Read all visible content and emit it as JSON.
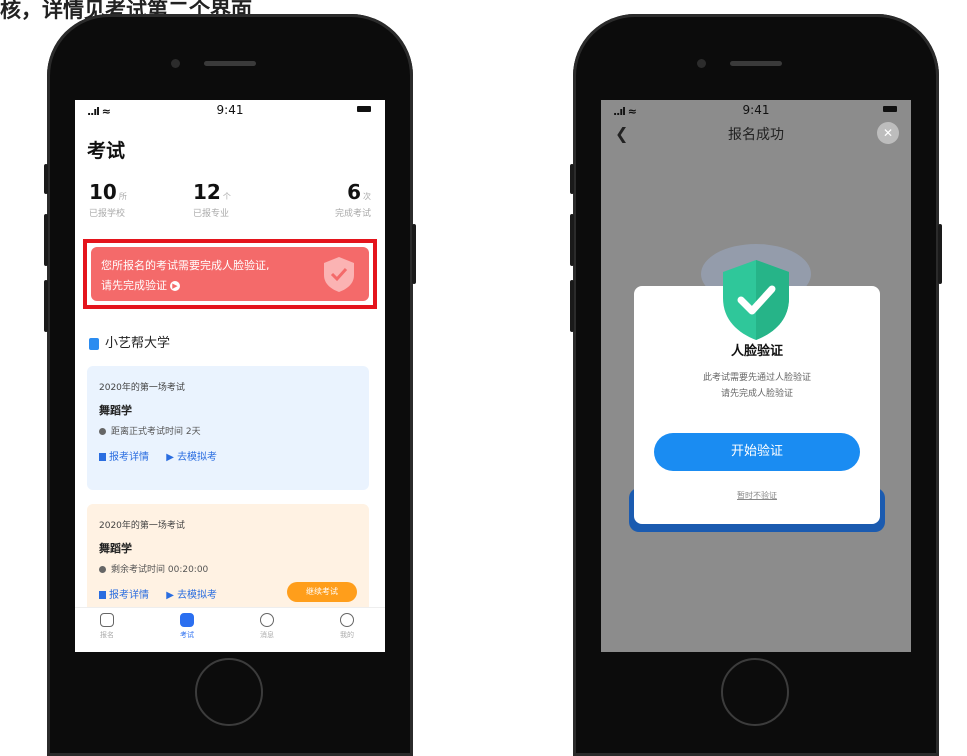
{
  "caption": "核，详情见考试第二个界面",
  "status": {
    "time": "9:41",
    "signal": "..ıl ≈"
  },
  "exam_page": {
    "title": "考试",
    "stats": [
      {
        "num": "10",
        "unit": "所",
        "label": "已报学校"
      },
      {
        "num": "12",
        "unit": "个",
        "label": "已报专业"
      },
      {
        "num": "6",
        "unit": "次",
        "label": "完成考试"
      }
    ],
    "banner": {
      "line1": "您所报名的考试需要完成人脸验证,",
      "line2": "请先完成验证"
    },
    "school": "小艺帮大学",
    "cards": [
      {
        "sub": "2020年的第一场考试",
        "name": "舞蹈学",
        "info": "距离正式考试时间 2天",
        "link1": "报考详情",
        "link2": "去模拟考",
        "bg": "#eaf3fe"
      },
      {
        "sub": "2020年的第一场考试",
        "name": "舞蹈学",
        "info": "剩余考试时间 00:20:00",
        "link1": "报考详情",
        "link2": "去模拟考",
        "button": "继续考试",
        "bg": "#fff2e3"
      }
    ],
    "tabs": [
      "报名",
      "考试",
      "消息",
      "我的"
    ]
  },
  "success_page": {
    "nav_title": "报名成功",
    "dialog": {
      "title": "人脸验证",
      "line1": "此考试需要先通过人脸验证",
      "line2": "请先完成人脸验证",
      "start": "开始验证",
      "later": "暂时不验证"
    }
  }
}
